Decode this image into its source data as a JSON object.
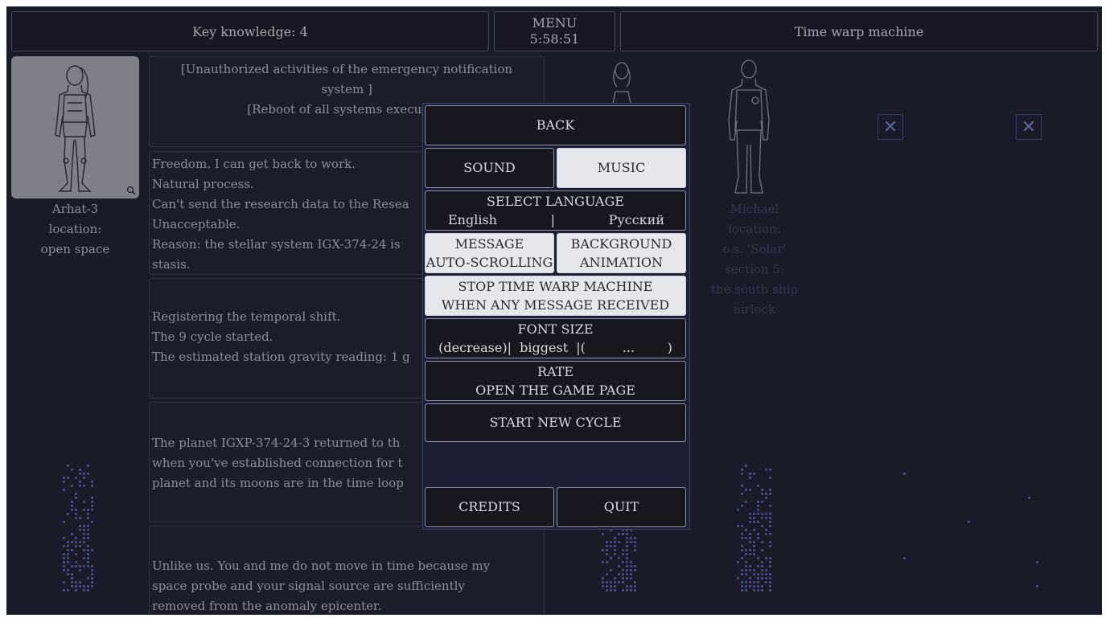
{
  "topbar": {
    "key_knowledge": "Key knowledge: 4",
    "menu_label": "MENU",
    "timer": "5:58:51",
    "right_title": "Time warp machine"
  },
  "characters": {
    "left": {
      "name": "Arhat-3",
      "location_label": "location:",
      "location": "open space"
    },
    "right": {
      "name": "Michael",
      "location_label": "location:",
      "location_lines": [
        "o.s. 'Solar'",
        "section 5:",
        "the south ship",
        "airlock"
      ]
    }
  },
  "messages": [
    {
      "lines": [
        "[Unauthorized activities of the emergency notification",
        "system ]",
        "[Reboot of all systems executed]"
      ]
    },
    {
      "lines": [
        "Freedom. I can get back to work.",
        "Natural process.",
        "Can't send the research data to the Resea",
        "Unacceptable.",
        "Reason: the stellar system IGX-374-24 is",
        "stasis."
      ]
    },
    {
      "lines": [
        "Registering the temporal shift.",
        "The 9 cycle started.",
        "The estimated station gravity reading: 1 g"
      ]
    },
    {
      "lines": [
        "The planet IGXP-374-24-3 returned to th",
        "when you've established connection for t",
        "planet and its moons are in the time loop"
      ]
    },
    {
      "lines": [
        "Unlike us. You and me do not move in time because my",
        "space probe and your signal source are sufficiently",
        "removed from the anomaly epicenter."
      ]
    }
  ],
  "empty_slot_icon": "close-x-icon",
  "menu": {
    "back": "BACK",
    "sound": "SOUND",
    "music": "MUSIC",
    "select_language": "SELECT LANGUAGE",
    "lang_english": "English",
    "lang_sep": "|",
    "lang_russian": "Русский",
    "message_auto_1": "MESSAGE",
    "message_auto_2": "AUTO-SCROLLING",
    "bg_anim_1": "BACKGROUND",
    "bg_anim_2": "ANIMATION",
    "stop_warp_1": "STOP TIME WARP MACHINE",
    "stop_warp_2": "WHEN ANY MESSAGE RECEIVED",
    "font_size": "FONT SIZE",
    "font_size_options": "(decrease)|  biggest  |(         ...        )",
    "rate": "RATE",
    "open_game_page": "OPEN THE GAME PAGE",
    "start_new_cycle": "START NEW CYCLE",
    "credits": "CREDITS",
    "quit": "QUIT"
  },
  "colors": {
    "background": "#1e1f2e",
    "button_dark": "#17181f",
    "button_active": "#e6e7ec",
    "accent_dots": "#5d63b0"
  }
}
